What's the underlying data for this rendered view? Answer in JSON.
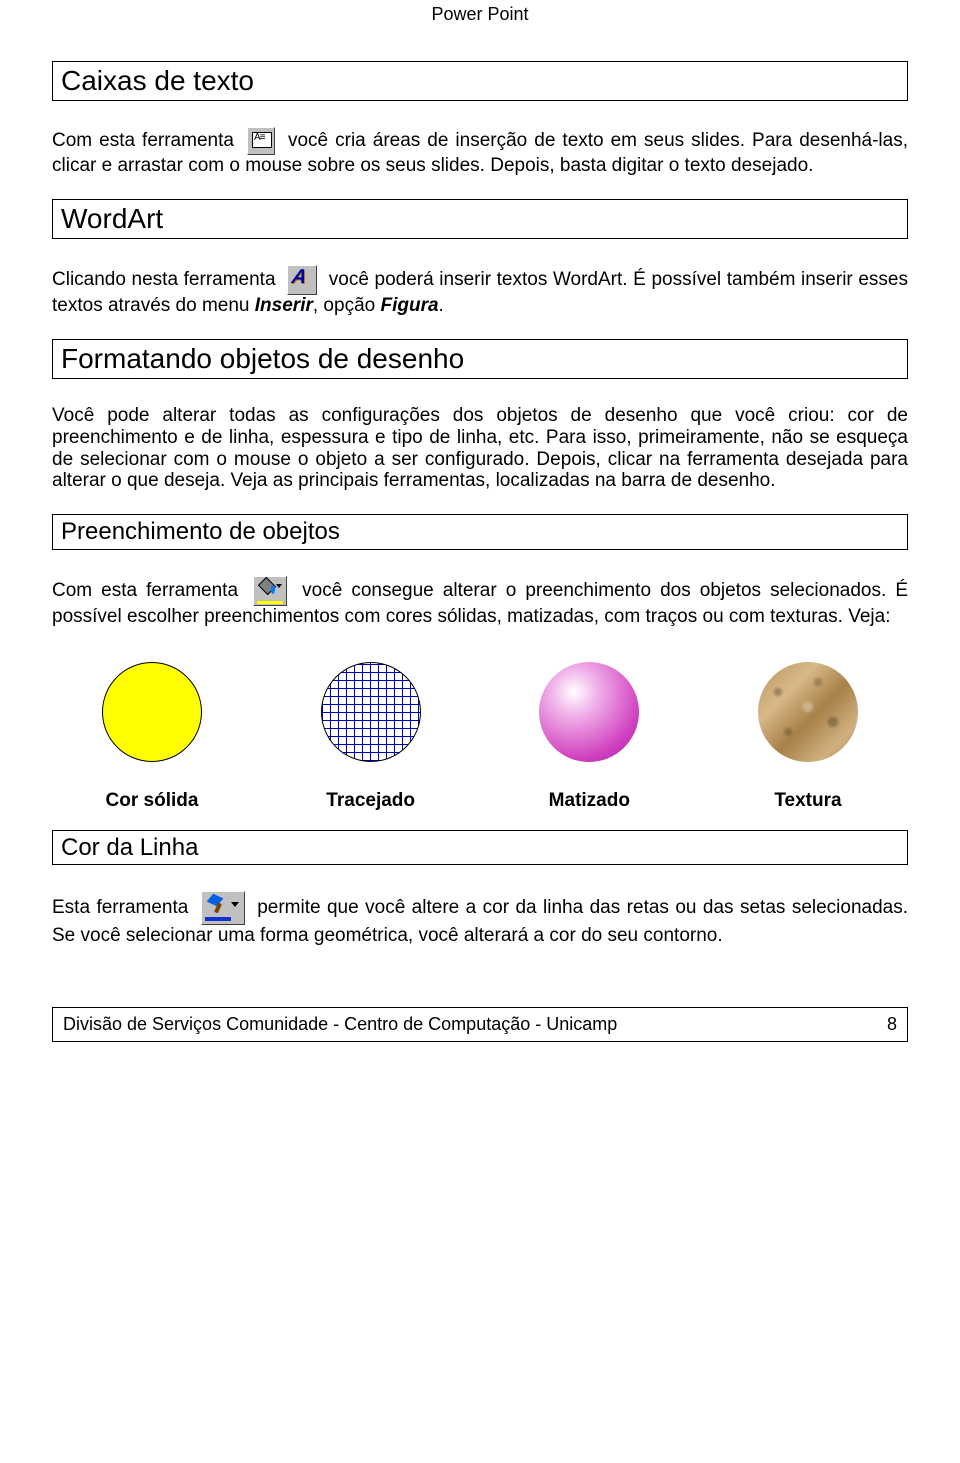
{
  "header": {
    "title": "Power Point"
  },
  "sections": {
    "caixas": {
      "title": "Caixas de texto",
      "p_before": "Com esta ferramenta",
      "p_after": "você cria áreas de inserção de texto em seus slides. Para desenhá-las, clicar e arrastar com o mouse sobre os seus slides. Depois, basta digitar o texto desejado."
    },
    "wordart": {
      "title": "WordArt",
      "p_before": "Clicando nesta ferramenta",
      "p_mid": "você poderá inserir textos WordArt. É possível também inserir esses textos através do menu ",
      "menu": "Inserir",
      "sep": ", opção ",
      "option": "Figura",
      "end": "."
    },
    "formatando": {
      "title": "Formatando objetos de desenho",
      "p": "Você pode alterar todas as configurações dos objetos de desenho que você criou: cor de preenchimento e de linha, espessura e tipo de linha, etc. Para isso, primeiramente, não se esqueça de selecionar com o mouse o objeto a ser configurado. Depois, clicar na ferramenta desejada para alterar o que deseja. Veja as principais ferramentas, localizadas na barra de desenho."
    },
    "preenchimento": {
      "title": "Preenchimento de obejtos",
      "p_before": "Com esta ferramenta",
      "p_after": "você consegue alterar o preenchimento dos objetos selecionados. É possível escolher preenchimentos com cores sólidas, matizadas, com traços ou com texturas. Veja:"
    },
    "cordalinha": {
      "title": "Cor da Linha",
      "p_before": "Esta ferramenta",
      "p_after": "permite que você altere a cor da linha das retas ou das setas selecionadas. Se você selecionar uma forma geométrica, você alterará a cor do seu contorno."
    }
  },
  "fills": {
    "solid": "Cor sólida",
    "hatch": "Tracejado",
    "grad": "Matizado",
    "tex": "Textura"
  },
  "footer": {
    "text": "Divisão de Serviços Comunidade - Centro de Computação - Unicamp",
    "page": "8"
  }
}
